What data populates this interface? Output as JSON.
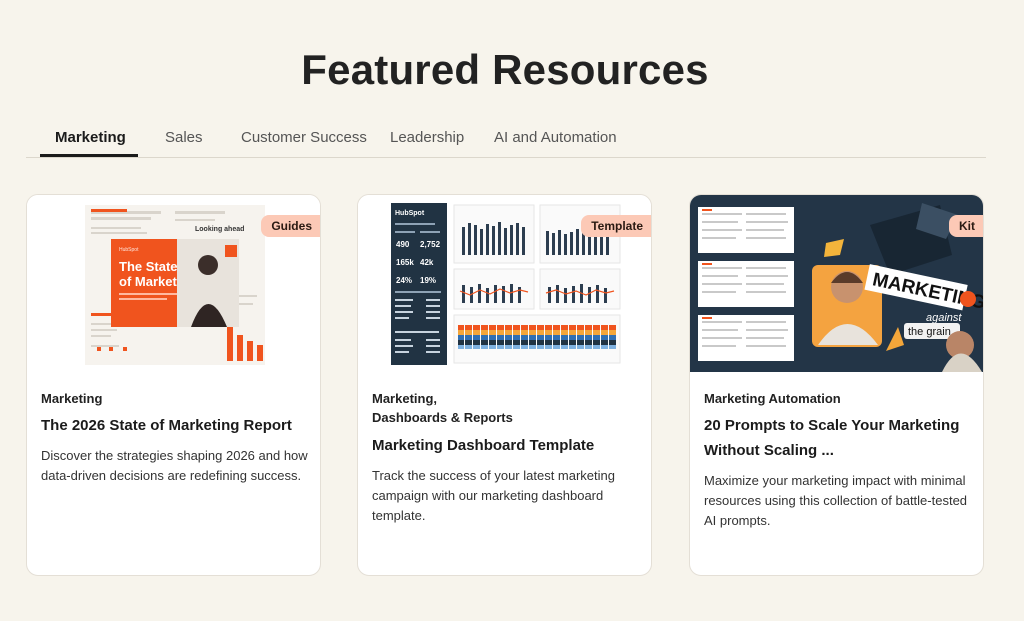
{
  "page": {
    "title": "Featured Resources"
  },
  "tabs": [
    {
      "label": "Marketing",
      "active": true
    },
    {
      "label": "Sales",
      "active": false
    },
    {
      "label": "Customer Success",
      "active": false
    },
    {
      "label": "Leadership",
      "active": false
    },
    {
      "label": "AI and Automation",
      "active": false
    }
  ],
  "cards": [
    {
      "badge": "Guides",
      "category_lines": [
        "Marketing"
      ],
      "title": "The 2026 State of Marketing Report",
      "description": "Discover the strategies shaping 2026 and how data-driven decisions are redefining success.",
      "image": {
        "cover_title": "The State of Marketing",
        "brand": "HubSpot"
      }
    },
    {
      "badge": "Template",
      "category_lines": [
        "Marketing,",
        "Dashboards & Reports"
      ],
      "title": "Marketing Dashboard Template",
      "description": "Track the success of your latest marketing campaign with our marketing dashboard template.",
      "image": {
        "brand": "HubSpot",
        "stats": [
          "490",
          "2,752",
          "165k",
          "42k",
          "24%",
          "19%"
        ]
      }
    },
    {
      "badge": "Kit",
      "category_lines": [
        "Marketing Automation"
      ],
      "title": "20 Prompts to Scale Your Marketing Without Scaling ...",
      "description": "Maximize your marketing impact with minimal resources using this collection of battle-tested AI prompts.",
      "image": {
        "headline": "MARKETING",
        "sub1": "against",
        "sub2": "the grain"
      }
    }
  ],
  "colors": {
    "background": "#f7f4ec",
    "badge": "#fcc9b6",
    "accent_orange": "#f0541e",
    "navy": "#213343"
  }
}
